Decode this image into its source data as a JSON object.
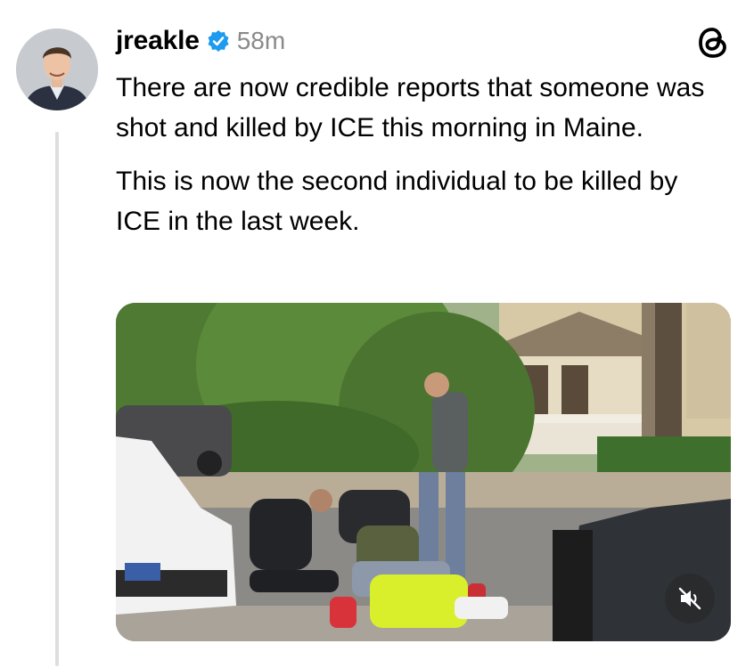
{
  "post": {
    "username": "jreakle",
    "verified": true,
    "timestamp": "58m",
    "paragraphs": [
      "There are now credible reports that someone was shot and killed by ICE this morning in Maine.",
      "This is now the second individual to be killed by ICE in the last week."
    ]
  },
  "media": {
    "type": "video",
    "muted": true
  },
  "icons": {
    "app_logo": "threads-logo-icon",
    "verified": "verified-badge-icon",
    "mute": "muted-speaker-icon"
  },
  "colors": {
    "verified_blue": "#1d9bf0",
    "timestamp_gray": "#8a8a8a",
    "thread_line": "#dedede"
  }
}
